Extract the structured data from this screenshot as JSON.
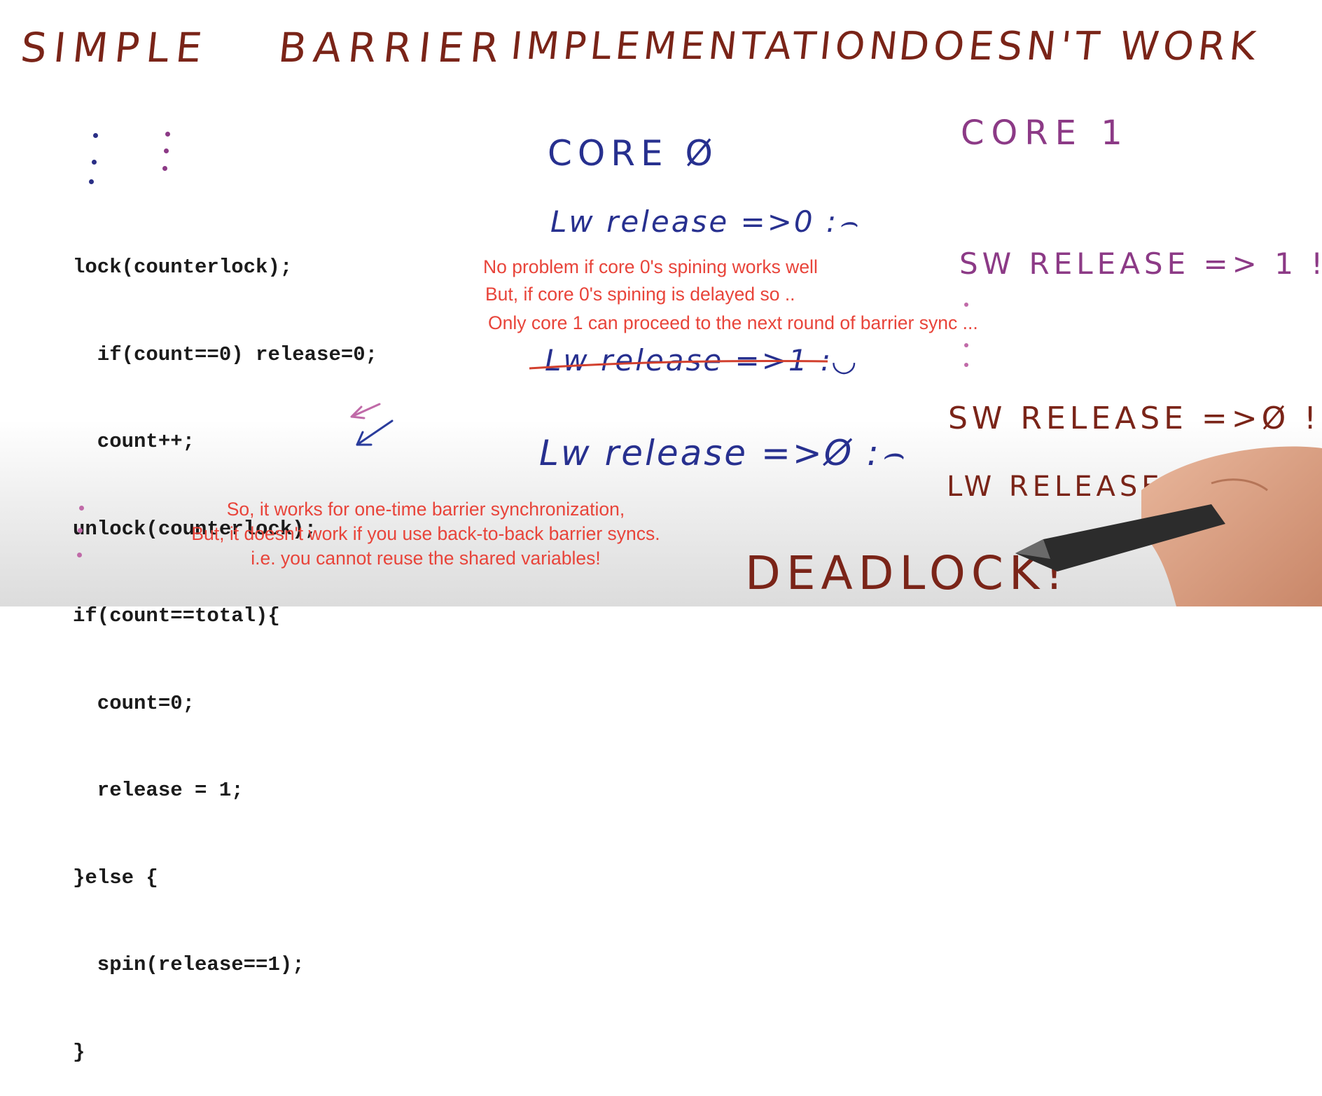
{
  "title": [
    "SIMPLE",
    "BARRIER",
    "IMPLEMENTATION",
    "DOESN'T WORK"
  ],
  "code_lines": [
    "lock(counterlock);",
    "  if(count==0) release=0;",
    "  count++;",
    "unlock(counterlock);",
    "if(count==total){",
    "  count=0;",
    "  release = 1;",
    "}else {",
    "  spin(release==1);",
    "}"
  ],
  "core0": {
    "heading": "CORE Ø",
    "lines": [
      "Lw release =>0 :⌢",
      "Lw release =>1 :◡",
      "Lw release =>Ø :⌢"
    ]
  },
  "core1": {
    "heading": "CORE 1",
    "lines": [
      "SW RELEASE => 1 !",
      "SW RELEASE =>Ø !",
      "LW RELEASE =>Ø :⌢"
    ]
  },
  "deadlock": "DEADLOCK!",
  "annotations": {
    "middle": [
      "No problem if core 0's spining works well",
      "But, if core 0's spining is delayed so ..",
      "Only core 1 can proceed to the next round of barrier sync ..."
    ],
    "bottom": [
      "So, it works for one-time barrier synchronization,",
      "But, it doesn't work if you use back-to-back barrier syncs.",
      "i.e. you cannot reuse the shared variables!"
    ]
  },
  "colors": {
    "title": "#7a2418",
    "core0": "#27308f",
    "core1": "#8c3a86",
    "overlay_text": "#e8443a",
    "strike": "#d2402e"
  }
}
